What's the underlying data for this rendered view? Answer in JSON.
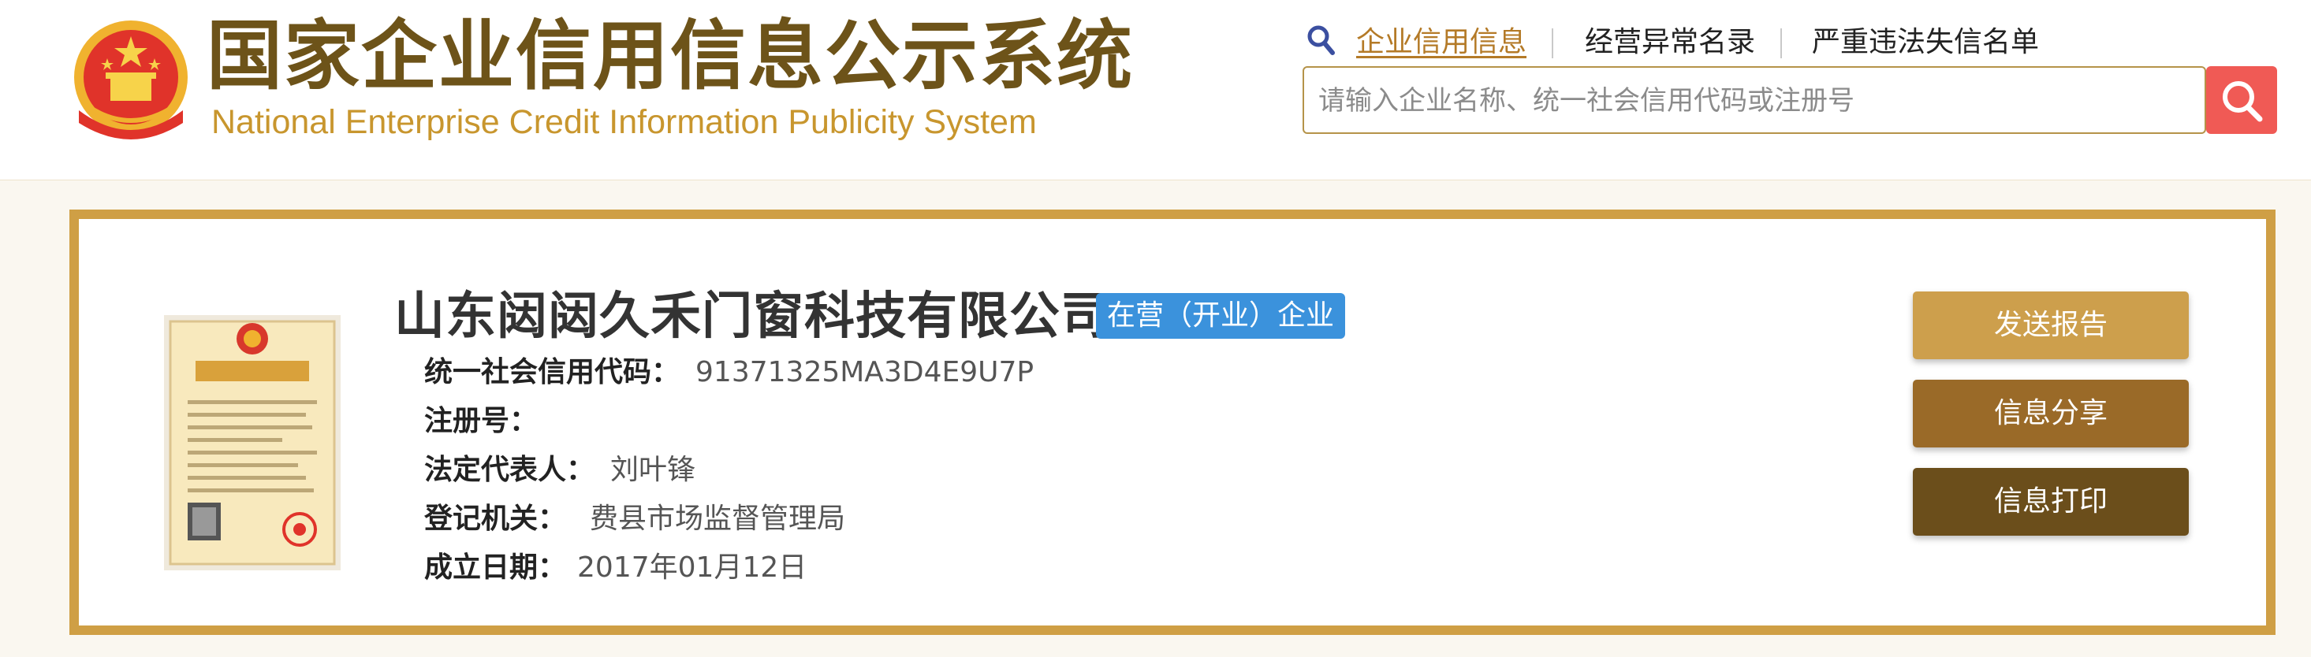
{
  "site": {
    "title_zh": "国家企业信用信息公示系统",
    "title_en": "National Enterprise Credit Information Publicity System",
    "emblem_icon": "national-emblem-icon"
  },
  "nav": {
    "items": [
      {
        "label": "企业信用信息",
        "active": true
      },
      {
        "label": "经营异常名录",
        "active": false
      },
      {
        "label": "严重违法失信名单",
        "active": false
      }
    ]
  },
  "search": {
    "placeholder": "请输入企业名称、统一社会信用代码或注册号",
    "value": "",
    "button_icon": "magnifier-icon"
  },
  "company": {
    "name": "山东闼闼久禾门窗科技有限公司",
    "status": "在营（开业）企业",
    "license_icon": "business-license-thumbnail",
    "fields": [
      {
        "label": "统一社会信用代码：",
        "value": "91371325MA3D4E9U7P"
      },
      {
        "label": "注册号：",
        "value": ""
      },
      {
        "label": "法定代表人：",
        "value": "刘叶锋"
      },
      {
        "label": "登记机关：",
        "value": "费县市场监督管理局"
      },
      {
        "label": "成立日期：",
        "value": "2017年01月12日"
      }
    ]
  },
  "actions": [
    {
      "label": "发送报告",
      "color": "#cd9f4c"
    },
    {
      "label": "信息分享",
      "color": "#9a6a28"
    },
    {
      "label": "信息打印",
      "color": "#6b4e1b"
    }
  ],
  "colors": {
    "brand_gold": "#cf9f45",
    "title_brown": "#6d5319",
    "search_red": "#f05a55",
    "status_blue": "#3b92dc"
  }
}
